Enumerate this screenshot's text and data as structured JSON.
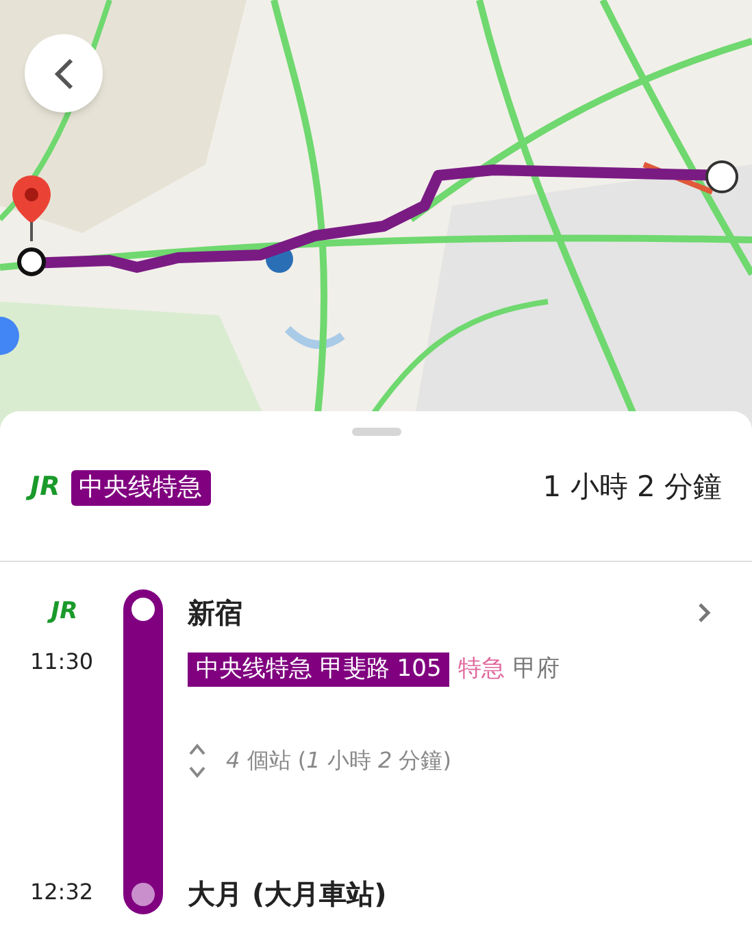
{
  "header": {
    "operator_logo": "JR",
    "line_badge": "中央线特急",
    "duration": "1 小時 2 分鐘"
  },
  "leg": {
    "operator_logo": "JR",
    "departure_time": "11:30",
    "arrival_time": "12:32",
    "departure_station": "新宿",
    "train_badge": "中央线特急 甲斐路 105",
    "train_type": "特急",
    "destination": "甲府",
    "stops_summary": "*4* 個站 (*1* 小時 *2* 分鐘)",
    "arrival_station": "大月 (大月車站)",
    "expanded": false
  }
}
